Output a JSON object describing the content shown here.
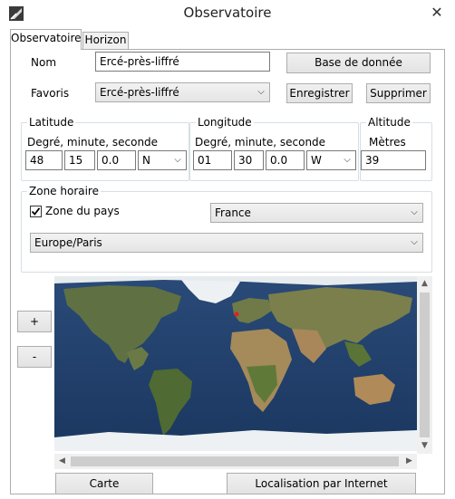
{
  "window": {
    "title": "Observatoire",
    "close_glyph": "✕"
  },
  "tabs": [
    {
      "label": "Observatoire",
      "active": true
    },
    {
      "label": "Horizon",
      "active": false
    }
  ],
  "form": {
    "nom_label": "Nom",
    "nom_value": "Ercé-près-liffré",
    "favoris_label": "Favoris",
    "favoris_value": "Ercé-près-liffré",
    "base_button": "Base de donnée",
    "enregistrer_button": "Enregistrer",
    "supprimer_button": "Supprimer"
  },
  "latitude": {
    "title": "Latitude",
    "subtitle": "Degré, minute, seconde",
    "deg": "48",
    "min": "15",
    "sec": "0.0",
    "hemisphere": "N"
  },
  "longitude": {
    "title": "Longitude",
    "subtitle": "Degré, minute, seconde",
    "deg": "01",
    "min": "30",
    "sec": "0.0",
    "hemisphere": "W"
  },
  "altitude": {
    "title": "Altitude",
    "subtitle": "Mètres",
    "value": "39"
  },
  "timezone": {
    "title": "Zone horaire",
    "country_checkbox_label": "Zone du pays",
    "country_checked": true,
    "country_value": "France",
    "zone_value": "Europe/Paris"
  },
  "zoom": {
    "plus": "+",
    "minus": "-"
  },
  "bottom_buttons": {
    "carte": "Carte",
    "localisation": "Localisation par Internet"
  },
  "icons": {
    "app": "observatory-icon",
    "dropdown": "chevron-down-icon",
    "scroll_up": "scroll-up-icon",
    "scroll_down": "scroll-down-icon",
    "scroll_left": "scroll-left-icon",
    "scroll_right": "scroll-right-icon"
  },
  "colors": {
    "ocean": "#1f3f6e",
    "land": "#5d6f3d",
    "desert": "#a58a5a",
    "ice": "#eef1f3",
    "marker": "#e02020"
  }
}
